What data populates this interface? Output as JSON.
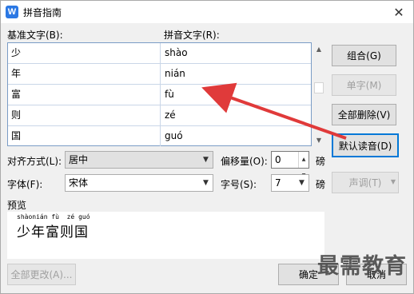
{
  "window": {
    "title": "拼音指南",
    "close_glyph": "✕",
    "app_icon_letter": "W"
  },
  "headers": {
    "base_text": "基准文字(B):",
    "pinyin_text": "拼音文字(R):"
  },
  "rows": [
    {
      "base": "少",
      "pinyin": "shào"
    },
    {
      "base": "年",
      "pinyin": "nián"
    },
    {
      "base": "富",
      "pinyin": "fù"
    },
    {
      "base": "则",
      "pinyin": "zé"
    },
    {
      "base": "国",
      "pinyin": "guó"
    }
  ],
  "buttons": {
    "combine": "组合(G)",
    "single": "单字(M)",
    "delete_all": "全部删除(V)",
    "default_reading": "默认读音(D)",
    "tone": "声调(T)",
    "change_all": "全部更改(A)...",
    "ok": "确定",
    "cancel": "取消"
  },
  "form": {
    "alignment_label": "对齐方式(L):",
    "alignment_value": "居中",
    "offset_label": "偏移量(O):",
    "offset_value": "0",
    "offset_unit": "磅",
    "font_label": "字体(F):",
    "font_value": "宋体",
    "size_label": "字号(S):",
    "size_value": "7",
    "size_unit": "磅"
  },
  "preview": {
    "label": "预览",
    "pinyin_line": "shàonián fù  zé guó",
    "base_line": "少年富则国"
  },
  "watermark": "最需教育",
  "colors": {
    "arrow": "#e03a3a",
    "focus": "#0078d7"
  },
  "icons": {
    "scroll_up": "▲",
    "scroll_down": "▼",
    "dropdown": "▼",
    "spin_up": "▲",
    "spin_down": "▼"
  }
}
